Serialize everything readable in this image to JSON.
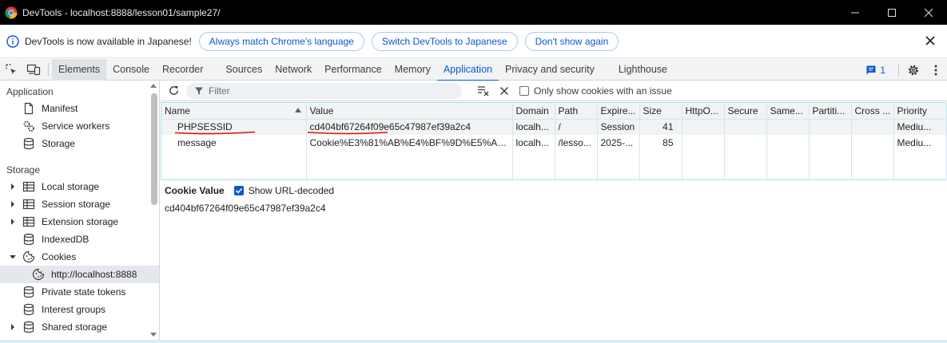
{
  "window": {
    "title": "DevTools - localhost:8888/lesson01/sample27/"
  },
  "infobar": {
    "message": "DevTools is now available in Japanese!",
    "buttons": [
      "Always match Chrome's language",
      "Switch DevTools to Japanese",
      "Don't show again"
    ]
  },
  "tabs": [
    "Elements",
    "Console",
    "Recorder",
    "Sources",
    "Network",
    "Performance",
    "Memory",
    "Application",
    "Privacy and security",
    "Lighthouse"
  ],
  "active_tab": "Application",
  "issues_count": "1",
  "sidebar": {
    "application_header": "Application",
    "application_items": [
      "Manifest",
      "Service workers",
      "Storage"
    ],
    "storage_header": "Storage",
    "storage_items": [
      "Local storage",
      "Session storage",
      "Extension storage",
      "IndexedDB",
      "Cookies",
      "http://localhost:8888",
      "Private state tokens",
      "Interest groups",
      "Shared storage"
    ]
  },
  "cookies_toolbar": {
    "filter_placeholder": "Filter",
    "only_issue_label": "Only show cookies with an issue"
  },
  "table": {
    "columns": [
      "Name",
      "Value",
      "Domain",
      "Path",
      "Expire...",
      "Size",
      "HttpO...",
      "Secure",
      "Same...",
      "Partiti...",
      "Cross ...",
      "Priority"
    ],
    "rows": [
      [
        "PHPSESSID",
        "cd404bf67264f09e65c47987ef39a2c4",
        "localh...",
        "/",
        "Session",
        "41",
        "",
        "",
        "",
        "",
        "",
        "Mediu..."
      ],
      [
        "message",
        "Cookie%E3%81%AB%E4%BF%9D%E5%AD%...",
        "localh...",
        "/lesso...",
        "2025-...",
        "85",
        "",
        "",
        "",
        "",
        "",
        "Mediu..."
      ]
    ]
  },
  "cookie_value": {
    "title": "Cookie Value",
    "decode_label": "Show URL-decoded",
    "value": "cd404bf67264f09e65c47987ef39a2c4"
  },
  "colors": {
    "accent": "#0b57d0",
    "annotation_red": "#e01010"
  }
}
